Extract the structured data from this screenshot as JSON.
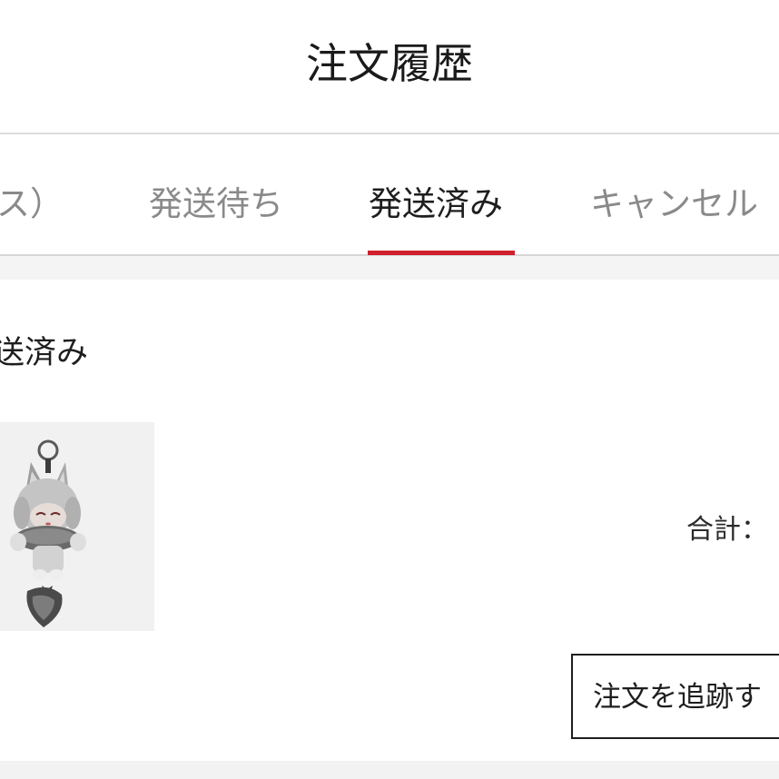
{
  "header": {
    "title": "注文履歴"
  },
  "tabs": [
    {
      "label": "ス）",
      "active": false
    },
    {
      "label": "発送待ち",
      "active": false
    },
    {
      "label": "発送済み",
      "active": true
    },
    {
      "label": "キャンセル",
      "active": false
    }
  ],
  "colors": {
    "accent": "#d0202e",
    "active_text": "#1e1e1e",
    "inactive_text": "#8a8a8a",
    "divider": "#d6d6d6",
    "band": "#f4f4f4"
  },
  "order": {
    "status": "送済み",
    "product_image_icon": "fox-girl-keychain-figure",
    "total_label": "合計：",
    "track_button_label": "注文を追跡す"
  }
}
